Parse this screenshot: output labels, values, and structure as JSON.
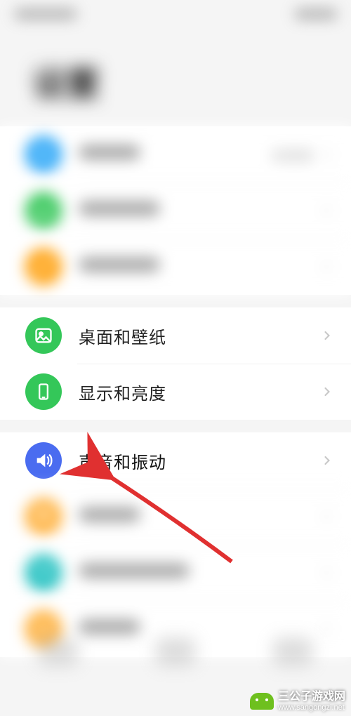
{
  "page": {
    "title": "设置"
  },
  "items": [
    {
      "id": "account",
      "label": "账号",
      "value": "未登录",
      "color": "c-blue",
      "group": 0,
      "blurred": true,
      "icon": "user"
    },
    {
      "id": "network",
      "label": "移动网络",
      "value": "",
      "color": "c-green",
      "group": 0,
      "blurred": true,
      "icon": "signal"
    },
    {
      "id": "connect",
      "label": "更多连接",
      "value": "",
      "color": "c-orange",
      "group": 0,
      "blurred": true,
      "icon": "link"
    },
    {
      "id": "wallpaper",
      "label": "桌面和壁纸",
      "value": "",
      "color": "c-green2",
      "group": 1,
      "blurred": false,
      "icon": "image"
    },
    {
      "id": "display",
      "label": "显示和亮度",
      "value": "",
      "color": "c-green2",
      "group": 1,
      "blurred": false,
      "icon": "phone"
    },
    {
      "id": "sound",
      "label": "声音和振动",
      "value": "",
      "color": "c-indigo",
      "group": 2,
      "blurred": false,
      "icon": "speaker",
      "highlight": true
    },
    {
      "id": "notify",
      "label": "通知",
      "value": "",
      "color": "c-orange2",
      "group": 2,
      "blurred": true,
      "icon": "bell"
    },
    {
      "id": "biometric",
      "label": "生物识别和密码",
      "value": "",
      "color": "c-teal",
      "group": 2,
      "blurred": true,
      "icon": "finger"
    },
    {
      "id": "apps",
      "label": "应用",
      "value": "",
      "color": "c-orange2",
      "group": 2,
      "blurred": true,
      "icon": "grid"
    }
  ],
  "watermark": {
    "main": "三公子游戏网",
    "sub": "www.sangongzi.net"
  }
}
